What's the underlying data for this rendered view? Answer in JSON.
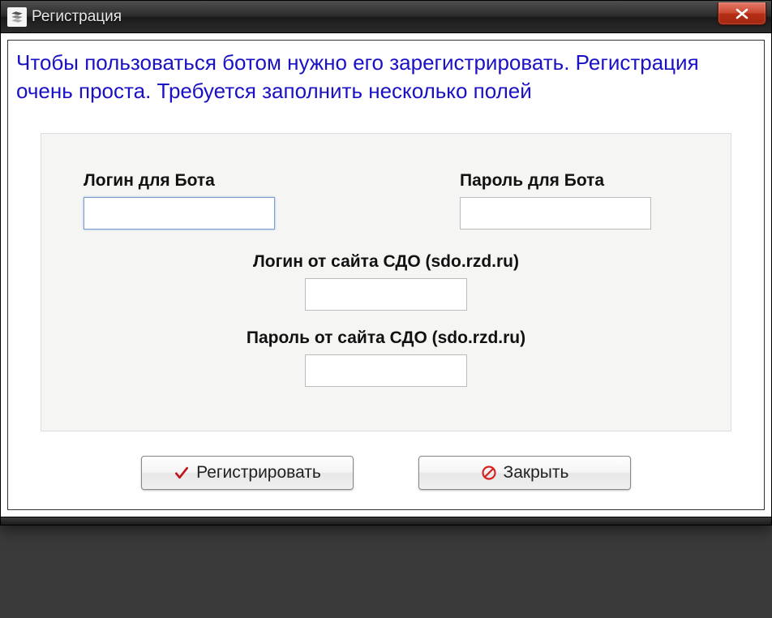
{
  "window": {
    "title": "Регистрация"
  },
  "description": "Чтобы пользоваться ботом нужно его зарегистрировать. Регистрация очень проста. Требуется заполнить несколько полей",
  "fields": {
    "bot_login": {
      "label": "Логин для Бота",
      "value": ""
    },
    "bot_password": {
      "label": "Пароль для Бота",
      "value": ""
    },
    "sdo_login": {
      "label": "Логин от сайта СДО (sdo.rzd.ru)",
      "value": ""
    },
    "sdo_password": {
      "label": "Пароль от сайта СДО (sdo.rzd.ru)",
      "value": ""
    }
  },
  "buttons": {
    "register": "Регистрировать",
    "close": "Закрыть"
  }
}
